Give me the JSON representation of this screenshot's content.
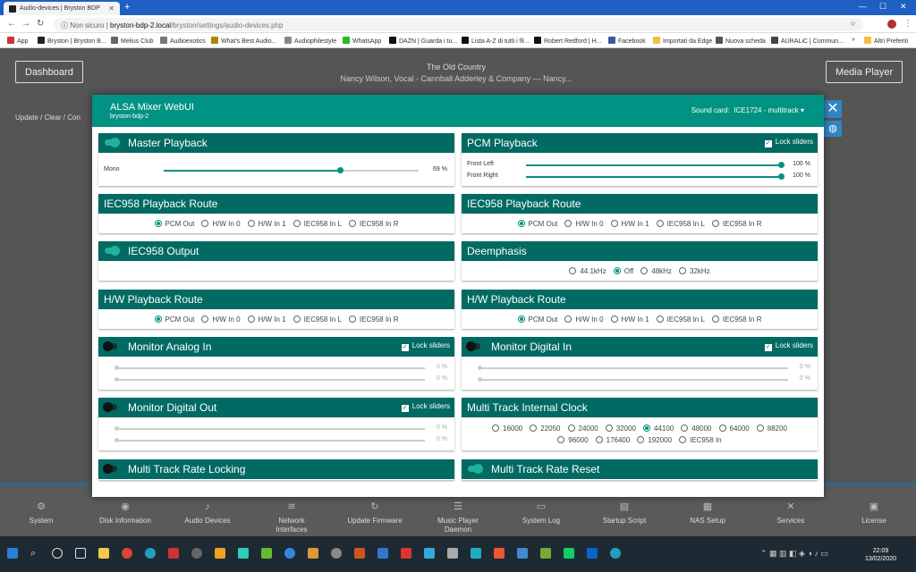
{
  "browser": {
    "tab_title": "Audio-devices | Bryston BDP",
    "new_tab": "+",
    "url_insecure": "Non sicuro",
    "url_domain": "bryston-bdp-2.local",
    "url_path": "/bryston/settings/audio-devices.php",
    "bookmarks": [
      "App",
      "Bryston | Bryston B...",
      "Melius Club",
      "Audioexotics",
      "What's Best Audio...",
      "Audiophilestyle",
      "WhatsApp",
      "DAZN | Guarda i tu...",
      "Lista A-Z di tutti i fil...",
      "Robert Redford | H...",
      "Facebook",
      "Importati da Edge",
      "Nuova scheda",
      "AURALiC | Commun..."
    ],
    "bookmarks_overflow": "»",
    "other_bookmarks": "Altri Preferiti"
  },
  "header": {
    "dashboard": "Dashboard",
    "media_player": "Media Player",
    "now_title": "The Old Country",
    "now_artist": "Nancy Wilson, Vocal - Cannball Adderley & Company — Nancy...",
    "links": "Update  /  Clear  /  Con"
  },
  "modal": {
    "title": "ALSA Mixer WebUI",
    "host": "bryston-bdp-2",
    "sound_card_label": "Sound card:",
    "sound_card_value": "ICE1724 - multitrack ▾",
    "lock_label": "Lock sliders"
  },
  "cards": {
    "master": {
      "title": "Master Playback",
      "slider_label": "Mono",
      "slider_value": "69 %",
      "slider_level": 69
    },
    "pcm": {
      "title": "PCM Playback",
      "fl_label": "Front Left",
      "fl_value": "100 %",
      "fl_level": 100,
      "fr_label": "Front Right",
      "fr_value": "100 %",
      "fr_level": 100
    },
    "iec_route_left": {
      "title": "IEC958 Playback Route",
      "options": [
        "PCM Out",
        "H/W In 0",
        "H/W In 1",
        "IEC958 In L",
        "IEC958 In R"
      ],
      "selected": 0
    },
    "iec_route_right": {
      "title": "IEC958 Playback Route",
      "options": [
        "PCM Out",
        "H/W In 0",
        "H/W In 1",
        "IEC958 In L",
        "IEC958 In R"
      ],
      "selected": 0
    },
    "iec_output": {
      "title": "IEC958 Output"
    },
    "deemphasis": {
      "title": "Deemphasis",
      "options": [
        "44.1kHz",
        "Off",
        "48kHz",
        "32kHz"
      ],
      "selected": 1
    },
    "hw_route_left": {
      "title": "H/W Playback Route",
      "options": [
        "PCM Out",
        "H/W In 0",
        "H/W In 1",
        "IEC958 In L",
        "IEC958 In R"
      ],
      "selected": 0
    },
    "hw_route_right": {
      "title": "H/W Playback Route",
      "options": [
        "PCM Out",
        "H/W In 0",
        "H/W In 1",
        "IEC958 In L",
        "IEC958 In R"
      ],
      "selected": 0
    },
    "monitor_analog": {
      "title": "Monitor Analog In",
      "v1": "0 %",
      "v2": "0 %"
    },
    "monitor_digital_in": {
      "title": "Monitor Digital In",
      "v1": "0 %",
      "v2": "0 %"
    },
    "monitor_digital_out": {
      "title": "Monitor Digital Out",
      "v1": "0 %",
      "v2": "0 %"
    },
    "clock": {
      "title": "Multi Track Internal Clock",
      "row1": [
        "16000",
        "22050",
        "24000",
        "32000",
        "44100",
        "48000",
        "64000",
        "88200"
      ],
      "row2": [
        "96000",
        "176400",
        "192000",
        "IEC958 In"
      ],
      "selected": "44100"
    },
    "rate_locking": {
      "title": "Multi Track Rate Locking"
    },
    "rate_reset": {
      "title": "Multi Track Rate Reset"
    }
  },
  "bottom_nav": [
    "System",
    "Disk Information",
    "Audio Devices",
    "Network Interfaces",
    "Update Firmware",
    "Music Player Daemon",
    "System Log",
    "Startup Script",
    "NAS Setup",
    "Services",
    "License"
  ],
  "clock": {
    "time": "22:09",
    "date": "13/02/2020"
  }
}
